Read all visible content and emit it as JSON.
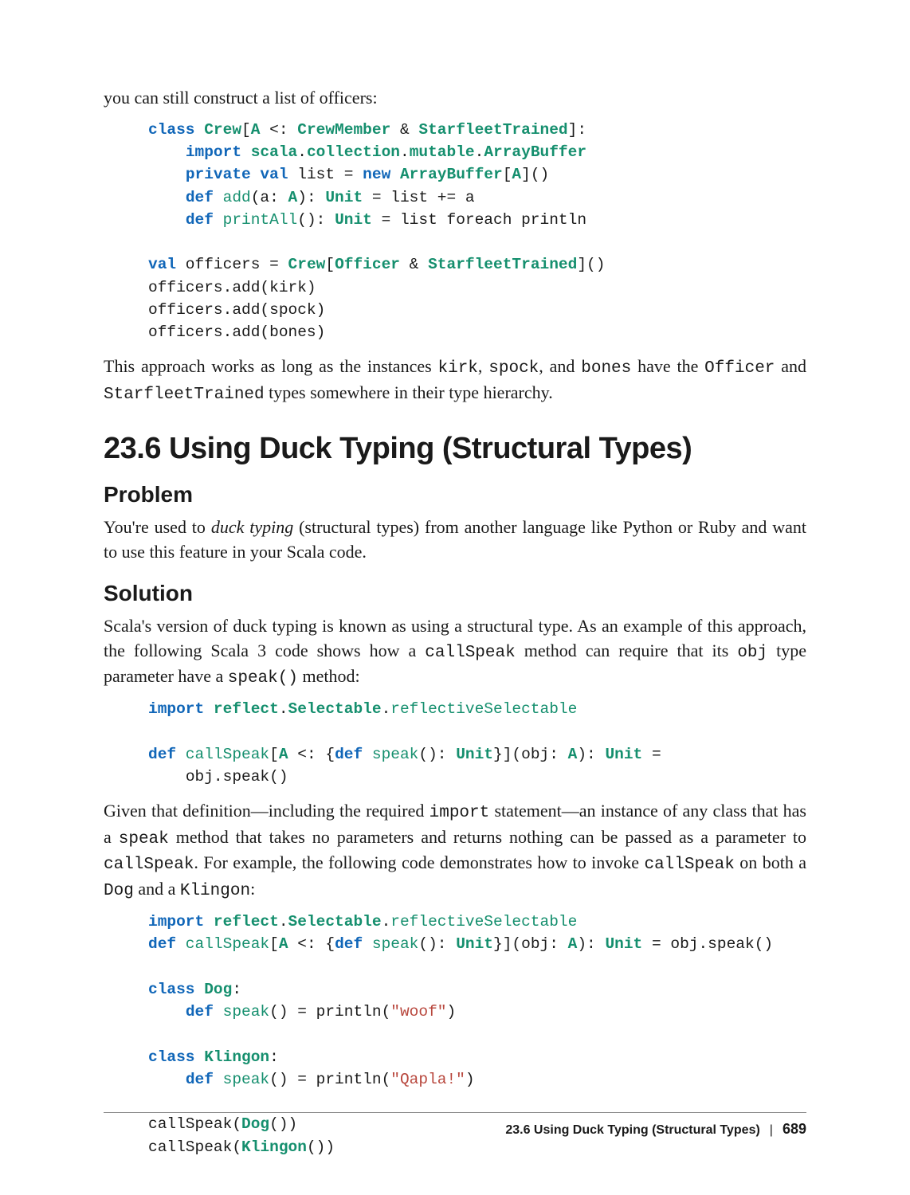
{
  "intro_text": "you can still construct a list of officers:",
  "code_block_1": {
    "l1": {
      "a": "class",
      "b": " Crew",
      "c": "[",
      "d": "A",
      "e": " <: ",
      "f": "CrewMember",
      "g": " & ",
      "h": "StarfleetTrained",
      "i": "]:"
    },
    "l2": {
      "a": "import",
      "b": " scala",
      "c": ".",
      "d": "collection",
      "e": ".",
      "f": "mutable",
      "g": ".",
      "h": "ArrayBuffer"
    },
    "l3": {
      "a": "private val",
      "b": " list = ",
      "c": "new",
      "d": " ArrayBuffer",
      "e": "[",
      "f": "A",
      "g": "]()"
    },
    "l4": {
      "a": "def",
      "b": " add",
      "c": "(a: ",
      "d": "A",
      "e": "): ",
      "f": "Unit",
      "g": " = list += a"
    },
    "l5": {
      "a": "def",
      "b": " printAll",
      "c": "(): ",
      "d": "Unit",
      "e": " = list foreach println"
    },
    "l6": {
      "a": "val",
      "b": " officers = ",
      "c": "Crew",
      "d": "[",
      "e": "Officer",
      "f": " & ",
      "g": "StarfleetTrained",
      "h": "]()"
    },
    "l7": "officers.add(kirk)",
    "l8": "officers.add(spock)",
    "l9": "officers.add(bones)"
  },
  "para_after_code1": {
    "a": "This approach works as long as the instances ",
    "b": "kirk",
    "c": ", ",
    "d": "spock",
    "e": ", and ",
    "f": "bones",
    "g": " have the ",
    "h": "Offi",
    "i": "cer",
    "j": " and ",
    "k": "StarfleetTrained",
    "l": " types somewhere in their type hierarchy."
  },
  "section_title": "23.6 Using Duck Typing (Structural Types)",
  "problem_heading": "Problem",
  "problem_text": {
    "a": "You're used to ",
    "b": "duck typing",
    "c": " (structural types) from another language like Python or Ruby and want to use this feature in your Scala code."
  },
  "solution_heading": "Solution",
  "solution_para1": {
    "a": "Scala's version of duck typing is known as using a structural type. As an example of this approach, the following Scala 3 code shows how a ",
    "b": "callSpeak",
    "c": " method can require that its ",
    "d": "obj",
    "e": " type parameter have a ",
    "f": "speak()",
    "g": " method:"
  },
  "code_block_2": {
    "l1": {
      "a": "import",
      "b": " reflect",
      "c": ".",
      "d": "Selectable",
      "e": ".",
      "f": "reflectiveSelectable"
    },
    "l2": {
      "a": "def",
      "b": " callSpeak",
      "c": "[",
      "d": "A",
      "e": " <: {",
      "f": "def",
      "g": " speak",
      "h": "(): ",
      "i": "Unit",
      "j": "}](obj: ",
      "k": "A",
      "l": "): ",
      "m": "Unit",
      "n": " ="
    },
    "l3": "obj.speak()"
  },
  "solution_para2": {
    "a": "Given that definition—including the required ",
    "b": "import",
    "c": " statement—an instance of any class that has a ",
    "d": "speak",
    "e": " method that takes no parameters and returns nothing can be passed as a parameter to ",
    "f": "callSpeak",
    "g": ". For example, the following code demonstrates how to invoke ",
    "h": "callSpeak",
    "i": " on both a ",
    "j": "Dog",
    "k": " and a ",
    "l": "Klingon",
    "m": ":"
  },
  "code_block_3": {
    "l1": {
      "a": "import",
      "b": " reflect",
      "c": ".",
      "d": "Selectable",
      "e": ".",
      "f": "reflectiveSelectable"
    },
    "l2": {
      "a": "def",
      "b": " callSpeak",
      "c": "[",
      "d": "A",
      "e": " <: {",
      "f": "def",
      "g": " speak",
      "h": "(): ",
      "i": "Unit",
      "j": "}](obj: ",
      "k": "A",
      "l": "): ",
      "m": "Unit",
      "n": " = obj.speak()"
    },
    "l3": {
      "a": "class",
      "b": " Dog",
      "c": ":"
    },
    "l4": {
      "a": "def",
      "b": " speak",
      "c": "() = println(",
      "d": "\"woof\"",
      "e": ")"
    },
    "l5": {
      "a": "class",
      "b": " Klingon",
      "c": ":"
    },
    "l6": {
      "a": "def",
      "b": " speak",
      "c": "() = println(",
      "d": "\"Qapla!\"",
      "e": ")"
    },
    "l7": {
      "a": "callSpeak(",
      "b": "Dog",
      "c": "())"
    },
    "l8": {
      "a": "callSpeak(",
      "b": "Klingon",
      "c": "())"
    }
  },
  "footer": {
    "title": "23.6 Using Duck Typing (Structural Types)",
    "sep": "|",
    "page": "689"
  }
}
